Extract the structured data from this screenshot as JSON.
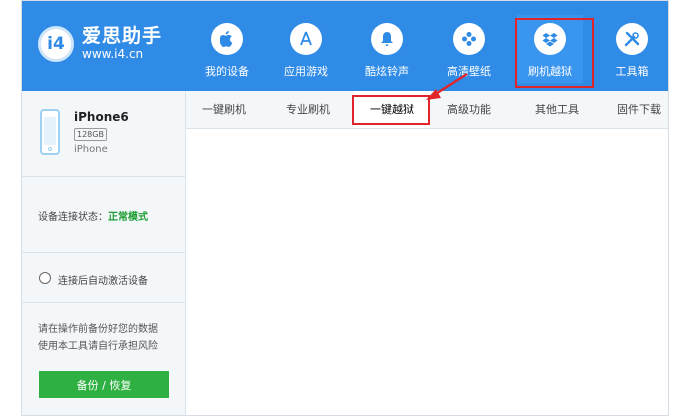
{
  "app": {
    "logo_mark": "i4",
    "name": "爱思助手",
    "url": "www.i4.cn"
  },
  "nav": {
    "items": [
      {
        "label": "我的设备",
        "icon": "apple-icon"
      },
      {
        "label": "应用游戏",
        "icon": "app-store-icon"
      },
      {
        "label": "酷炫铃声",
        "icon": "bell-icon"
      },
      {
        "label": "高清壁纸",
        "icon": "flower-icon"
      },
      {
        "label": "刷机越狱",
        "icon": "dropbox-icon"
      },
      {
        "label": "工具箱",
        "icon": "tools-icon"
      }
    ],
    "active_index": 4
  },
  "device": {
    "name": "iPhone6",
    "capacity": "128GB",
    "model": "iPhone"
  },
  "status": {
    "label": "设备连接状态：",
    "value": "正常模式",
    "value_color": "#1e9e34"
  },
  "auto_activate": {
    "label": "连接后自动激活设备",
    "checked": false
  },
  "warning": {
    "line1": "请在操作前备份好您的数据",
    "line2": "使用本工具请自行承担风险"
  },
  "backup_button": {
    "label": "备份 / 恢复"
  },
  "tabs": {
    "items": [
      "一键刷机",
      "专业刷机",
      "一键越狱",
      "高级功能",
      "其他工具",
      "固件下载"
    ],
    "active_index": 2
  },
  "colors": {
    "header": "#2f8be6",
    "highlight": "#e0242a",
    "button": "#2fb043"
  }
}
